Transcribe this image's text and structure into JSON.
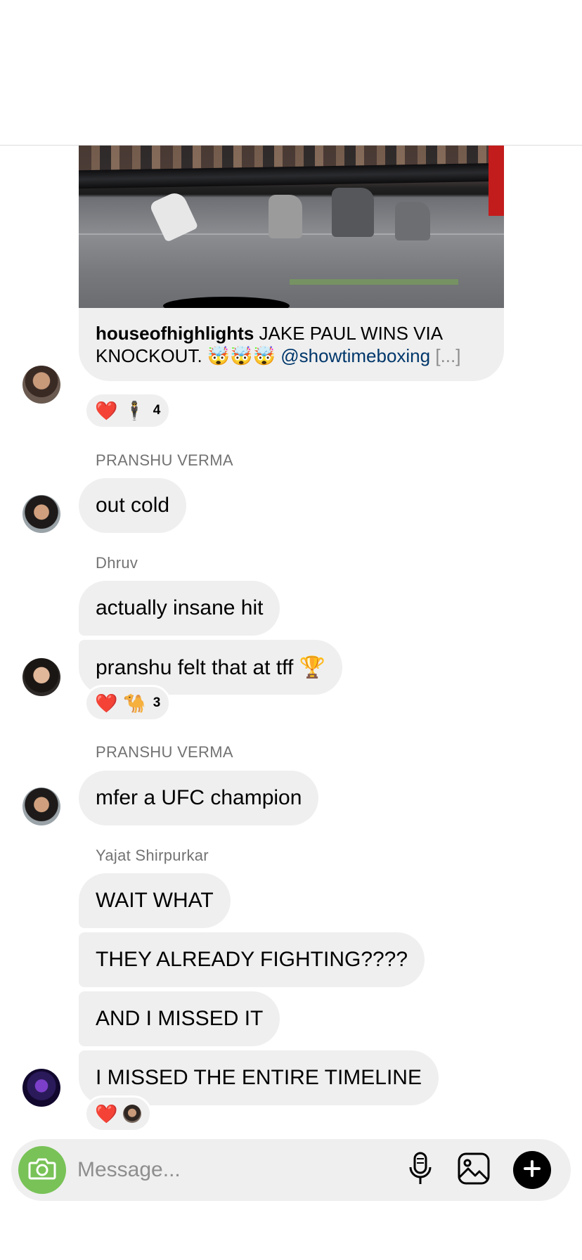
{
  "post": {
    "username": "houseofhighlights",
    "caption": "JAKE PAUL WINS VIA KNOCKOUT.",
    "emojis": "🤯🤯🤯",
    "handle": "@showtimeboxing",
    "more": "[...]",
    "reactions": {
      "emoji1": "❤️",
      "emoji2": "🕴",
      "count": "4"
    }
  },
  "messages": [
    {
      "sender": "PRANSHU VERMA",
      "texts": [
        "out cold"
      ]
    },
    {
      "sender": "Dhruv",
      "texts": [
        "actually insane hit",
        "pranshu felt that at tff 🏆"
      ],
      "reactions": {
        "emoji1": "❤️",
        "emoji2": "🐪",
        "count": "3"
      }
    },
    {
      "sender": "PRANSHU VERMA",
      "texts": [
        "mfer a UFC champion"
      ]
    },
    {
      "sender": "Yajat Shirpurkar",
      "texts": [
        "WAIT WHAT",
        "THEY ALREADY FIGHTING????",
        "AND I MISSED IT",
        "I MISSED THE ENTIRE TIMELINE"
      ],
      "reactions": {
        "emoji1": "❤️"
      }
    }
  ],
  "composer": {
    "placeholder": "Message...",
    "icons": [
      "camera-icon",
      "microphone-icon",
      "gallery-icon",
      "plus-icon"
    ]
  },
  "colors": {
    "bubble": "#efefef",
    "camera": "#78c257",
    "handle": "#00376b",
    "meta": "#737373"
  }
}
